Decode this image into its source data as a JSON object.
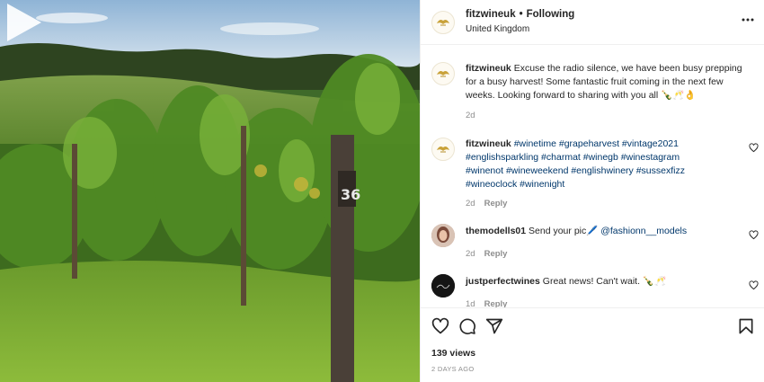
{
  "header": {
    "username": "fitzwineuk",
    "separator": "•",
    "follow_status": "Following",
    "location": "United Kingdom",
    "more_icon": "ellipsis-vertical-icon"
  },
  "caption": {
    "username": "fitzwineuk",
    "text": "Excuse the radio silence, we have been busy prepping for a busy harvest! Some fantastic fruit coming in the next few weeks. Looking forward to sharing with you all 🍾🥂👌",
    "time": "2d"
  },
  "comments": [
    {
      "username": "fitzwineuk",
      "text": "#winetime #grapeharvest #vintage2021 #englishsparkling #charmat #winegb #winestagram #winenot #wineweekend #englishwinery #sussexfizz #wineoclock #winenight",
      "time": "2d",
      "reply": "Reply"
    },
    {
      "username": "themodells01",
      "text": "Send your pic🖊️",
      "mention": "@fashionn__models",
      "time": "2d",
      "reply": "Reply"
    },
    {
      "username": "justperfectwines",
      "text": "Great news! Can't wait. 🍾🥂",
      "time": "1d",
      "reply": "Reply"
    }
  ],
  "stats": {
    "views": "139 views",
    "posted": "2 DAYS AGO"
  },
  "icons": {
    "like": "heart-icon",
    "comment": "comment-icon",
    "share": "paper-plane-icon",
    "save": "bookmark-icon",
    "play": "play-icon"
  },
  "colors": {
    "link": "#00376b",
    "muted": "#8e8e8e",
    "text": "#262626"
  }
}
